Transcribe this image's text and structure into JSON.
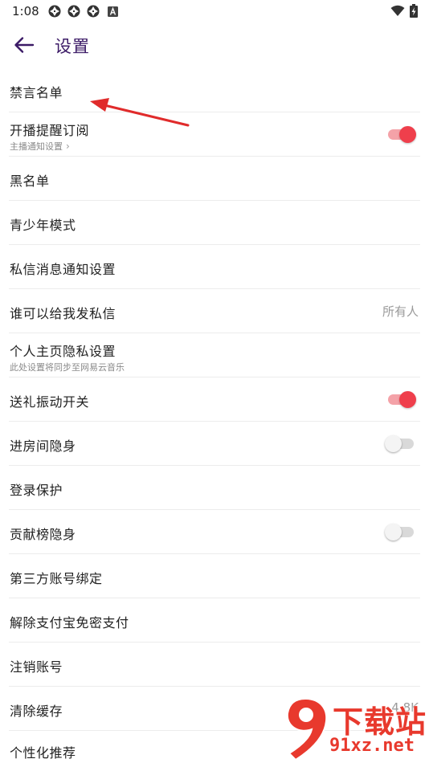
{
  "status_bar": {
    "time": "1:08",
    "notification_icons": [
      "aperture-icon",
      "aperture-icon",
      "aperture-icon",
      "a-box-icon"
    ],
    "right_icons": [
      "wifi-icon",
      "battery-charging-icon"
    ]
  },
  "header": {
    "title": "设置",
    "back_icon": "arrow-left-icon",
    "accent_color": "#3b1a66"
  },
  "settings": [
    {
      "label": "禁言名单"
    },
    {
      "label": "开播提醒订阅",
      "sub": "主播通知设置",
      "toggle": true
    },
    {
      "label": "黑名单"
    },
    {
      "label": "青少年模式"
    },
    {
      "label": "私信消息通知设置"
    },
    {
      "label": "谁可以给我发私信",
      "value": "所有人"
    },
    {
      "label": "个人主页隐私设置",
      "sub": "此处设置将同步至网易云音乐"
    },
    {
      "label": "送礼振动开关",
      "toggle": true
    },
    {
      "label": "进房间隐身",
      "toggle": false
    },
    {
      "label": "登录保护"
    },
    {
      "label": "贡献榜隐身",
      "toggle": false
    },
    {
      "label": "第三方账号绑定"
    },
    {
      "label": "解除支付宝免密支付"
    },
    {
      "label": "注销账号"
    },
    {
      "label": "清除缓存",
      "value": "4.8K"
    },
    {
      "label": "个性化推荐"
    }
  ],
  "colors": {
    "toggle_on_knob": "#ef3f4c",
    "toggle_on_track": "#f4a2a8",
    "toggle_off_track": "#d9d9d9",
    "annotation_arrow": "#e02b2b",
    "watermark": "#e8392d"
  },
  "watermark": {
    "line1": "下载站",
    "line2": "91xz.net"
  }
}
